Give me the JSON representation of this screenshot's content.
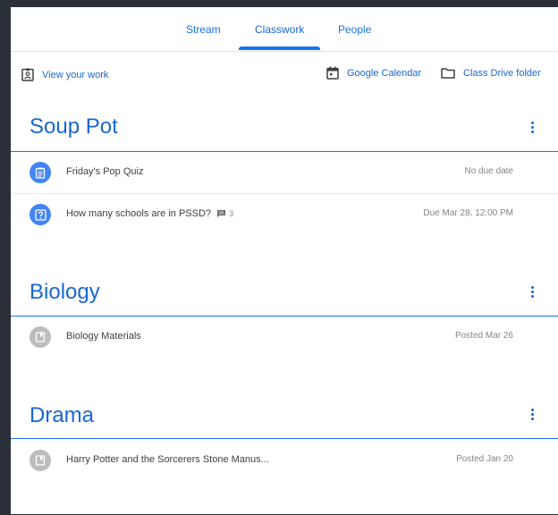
{
  "tabs": [
    {
      "label": "Stream",
      "active": false
    },
    {
      "label": "Classwork",
      "active": true
    },
    {
      "label": "People",
      "active": false
    }
  ],
  "toolbar": {
    "view_work": {
      "label": "View your work",
      "icon": "badge-icon"
    },
    "calendar": {
      "label": "Google Calendar",
      "icon": "calendar-icon"
    },
    "drive": {
      "label": "Class Drive folder",
      "icon": "folder-icon"
    }
  },
  "topics": [
    {
      "title": "Soup Pot",
      "items": [
        {
          "title": "Friday's Pop Quiz",
          "meta": "No due date",
          "icon": "assignment-icon",
          "icon_color": "#4285f4"
        },
        {
          "title": "How many schools are in PSSD?",
          "meta": "Due Mar 28, 12:00 PM",
          "icon": "question-icon",
          "icon_color": "#4285f4",
          "comments": "3"
        }
      ]
    },
    {
      "title": "Biology",
      "items": [
        {
          "title": "Biology Materials",
          "meta": "Posted Mar 26",
          "icon": "material-icon",
          "icon_color": "#bdbdbd"
        }
      ]
    },
    {
      "title": "Drama",
      "items": [
        {
          "title": "Harry Potter and the Sorcerers Stone Manus...",
          "meta": "Posted Jan 20",
          "icon": "material-icon",
          "icon_color": "#bdbdbd"
        }
      ]
    }
  ],
  "colors": {
    "accent": "#1a73e8",
    "topic_title": "#1967d2",
    "frame_bg": "#2b2f38"
  }
}
